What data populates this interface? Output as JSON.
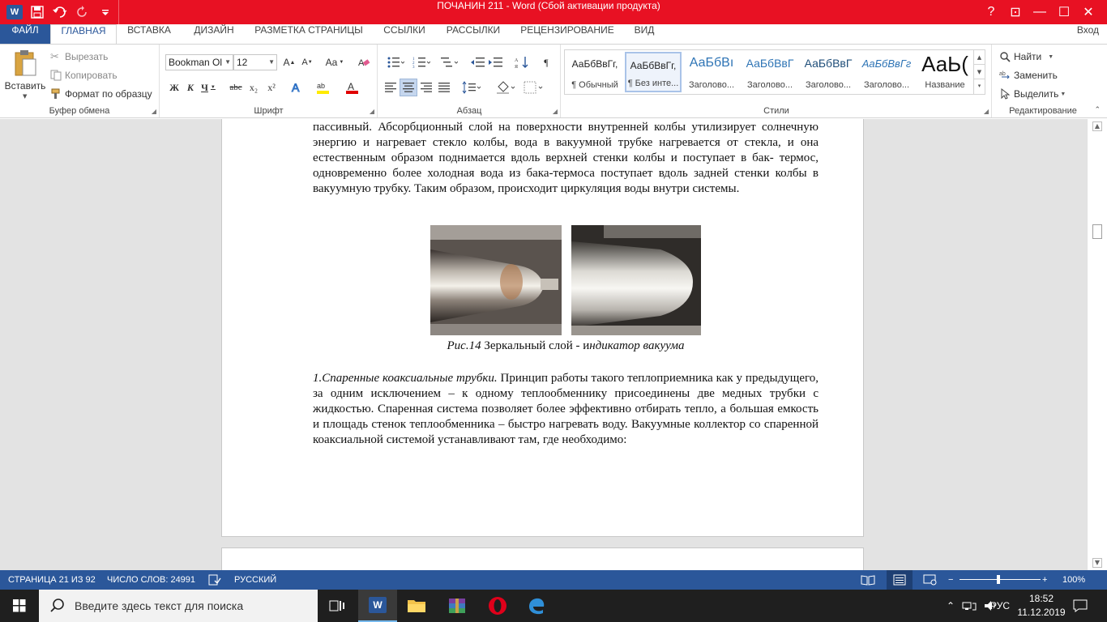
{
  "title_bar": {
    "window_title": "ПОЧАНИН 211 -  Word (Сбой активации продукта)",
    "buttons": {
      "help": "?",
      "ribbon_options": "⊡",
      "minimize": "—",
      "maximize": "☐",
      "close": "✕"
    }
  },
  "tabs": [
    "ФАЙЛ",
    "ГЛАВНАЯ",
    "ВСТАВКА",
    "ДИЗАЙН",
    "РАЗМЕТКА СТРАНИЦЫ",
    "ССЫЛКИ",
    "РАССЫЛКИ",
    "РЕЦЕНЗИРОВАНИЕ",
    "ВИД"
  ],
  "active_tab": "ГЛАВНАЯ",
  "signin": "Вход",
  "ribbon": {
    "clipboard": {
      "label": "Буфер обмена",
      "paste": "Вставить",
      "cut": "Вырезать",
      "copy": "Копировать",
      "format_painter": "Формат по образцу"
    },
    "font": {
      "label": "Шрифт",
      "font_name": "Bookman Ol",
      "font_size": "12",
      "bold": "Ж",
      "italic": "К",
      "underline": "Ч",
      "strike": "abc",
      "subscript": "x₂",
      "superscript": "x²",
      "grow": "A",
      "shrink": "A",
      "case": "Aa"
    },
    "paragraph": {
      "label": "Абзац"
    },
    "styles": {
      "label": "Стили",
      "items": [
        {
          "sample": "АаБбВвГг,",
          "name": "¶ Обычный"
        },
        {
          "sample": "АаБбВвГг,",
          "name": "¶ Без инте..."
        },
        {
          "sample": "АаБбВı",
          "name": "Заголово..."
        },
        {
          "sample": "АаБбВвГ",
          "name": "Заголово..."
        },
        {
          "sample": "АаБбВвГ",
          "name": "Заголово..."
        },
        {
          "sample": "АаБбВвГг",
          "name": "Заголово..."
        },
        {
          "sample": "АаЬ(",
          "name": "Название"
        }
      ]
    },
    "editing": {
      "label": "Редактирование",
      "find": "Найти",
      "replace": "Заменить",
      "select": "Выделить"
    }
  },
  "document": {
    "para1": "пассивный. Абсорбционный слой на поверхности внутренней колбы утилизирует солнечную энергию и нагревает стекло колбы, вода в вакуумной трубке нагревается от стекла, и она естественным образом поднимается вдоль верхней стенки колбы и поступает в бак- термос, одновременно более холодная вода из бака-термоса поступает вдоль задней стенки колбы в вакуумную трубку. Таким образом, происходит циркуляция воды внутри системы.",
    "caption_prefix": "Рис.14",
    "caption_middle": " Зеркальный слой - и",
    "caption_suffix": "ндикатор вакуума",
    "para2_lead": "1.Спаренные коаксиальные трубки.",
    "para2_rest": " Принцип работы такого теплоприемника как у предыдущего, за одним исключением – к одному теплообменнику присоединены две медных трубки с жидкостью. Спаренная система позволяет более эффективно отбирать тепло, а большая емкость и площадь стенок теплообменника – быстро нагревать воду. Вакуумные коллектор со спаренной коаксиальной системой устанавливают там, где необходимо:"
  },
  "status_bar": {
    "page": "СТРАНИЦА 21 ИЗ 92",
    "words": "ЧИСЛО СЛОВ: 24991",
    "language": "РУССКИЙ",
    "zoom": "100%"
  },
  "taskbar": {
    "search_placeholder": "Введите здесь текст для поиска",
    "language": "РУС",
    "time": "18:52",
    "date": "11.12.2019"
  },
  "colors": {
    "title_bar": "#e81123",
    "word_blue": "#2b579a"
  }
}
